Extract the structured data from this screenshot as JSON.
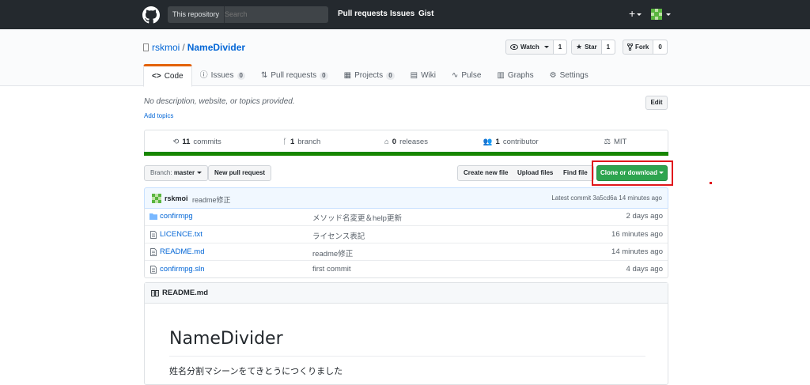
{
  "header": {
    "search_scope": "This repository",
    "search_placeholder": "Search",
    "nav": [
      "Pull requests",
      "Issues",
      "Gist"
    ],
    "plus": "+"
  },
  "repo": {
    "owner": "rskmoi",
    "separator": "/",
    "name": "NameDivider",
    "watch": {
      "label": "Watch",
      "count": "1"
    },
    "star": {
      "label": "Star",
      "count": "1"
    },
    "fork": {
      "label": "Fork",
      "count": "0"
    },
    "tabs": [
      {
        "label": "Code"
      },
      {
        "label": "Issues",
        "count": "0"
      },
      {
        "label": "Pull requests",
        "count": "0"
      },
      {
        "label": "Projects",
        "count": "0"
      },
      {
        "label": "Wiki"
      },
      {
        "label": "Pulse"
      },
      {
        "label": "Graphs"
      },
      {
        "label": "Settings"
      }
    ]
  },
  "about": {
    "description": "No description, website, or topics provided.",
    "add_topics": "Add topics",
    "edit_label": "Edit"
  },
  "summary": {
    "commits": {
      "num": "11",
      "label": "commits"
    },
    "branch": {
      "num": "1",
      "label": "branch"
    },
    "releases": {
      "num": "0",
      "label": "releases"
    },
    "contributor": {
      "num": "1",
      "label": "contributor"
    },
    "license": "MIT"
  },
  "colors": {
    "language_bar": "#178600",
    "clone_button": "#2ea44f",
    "highlight": "#e0161c"
  },
  "filenav": {
    "branch_label": "Branch:",
    "branch_name": "master",
    "new_pull": "New pull request",
    "create_file": "Create new file",
    "upload": "Upload files",
    "find": "Find file",
    "clone": "Clone or download"
  },
  "commit": {
    "author": "rskmoi",
    "message": "readme修正",
    "latest": "Latest commit 3a5cd6a 14 minutes ago"
  },
  "files": [
    {
      "name": "confirmpg",
      "icon": "folder-icon",
      "message": "メソッド名変更＆help更新",
      "age": "2 days ago"
    },
    {
      "name": "LICENCE.txt",
      "icon": "file-icon",
      "message": "ライセンス表記",
      "age": "16 minutes ago"
    },
    {
      "name": "README.md",
      "icon": "file-icon",
      "message": "readme修正",
      "age": "14 minutes ago"
    },
    {
      "name": "confirmpg.sln",
      "icon": "file-icon",
      "message": "first commit",
      "age": "4 days ago"
    }
  ],
  "readme": {
    "header": "README.md",
    "title": "NameDivider",
    "text": "姓名分割マシーンをてきとうにつくりました"
  }
}
